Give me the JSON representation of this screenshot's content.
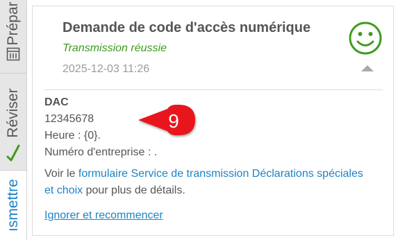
{
  "sidebar": {
    "tabs": [
      {
        "label": "Prépar"
      },
      {
        "label": "Réviser"
      },
      {
        "label": "ısmettre"
      }
    ]
  },
  "card": {
    "title": "Demande de code d'accès numérique",
    "status": "Transmission réussie",
    "timestamp": "2025-12-03 11:26",
    "code_label": "DAC",
    "code_value": "12345678",
    "hour_line": "Heure : {0}.",
    "enterprise_line": "Numéro d'entreprise : .",
    "para_prefix": "Voir le ",
    "para_link": "formulaire Service de transmission Déclarations spéciales et choix",
    "para_suffix": " pour plus de détails.",
    "reset_link": "Ignorer et recommencer"
  },
  "badge": {
    "number": "9"
  },
  "colors": {
    "accent_blue": "#1c83c5",
    "success_green": "#3e9c1f",
    "badge_red": "#e8141c",
    "text_gray": "#555555"
  },
  "icons": {
    "status_icon": "smiley-icon",
    "collapse_icon": "chevron-up-icon",
    "prepare_icon": "form-icon",
    "review_icon": "checkmark-icon"
  }
}
